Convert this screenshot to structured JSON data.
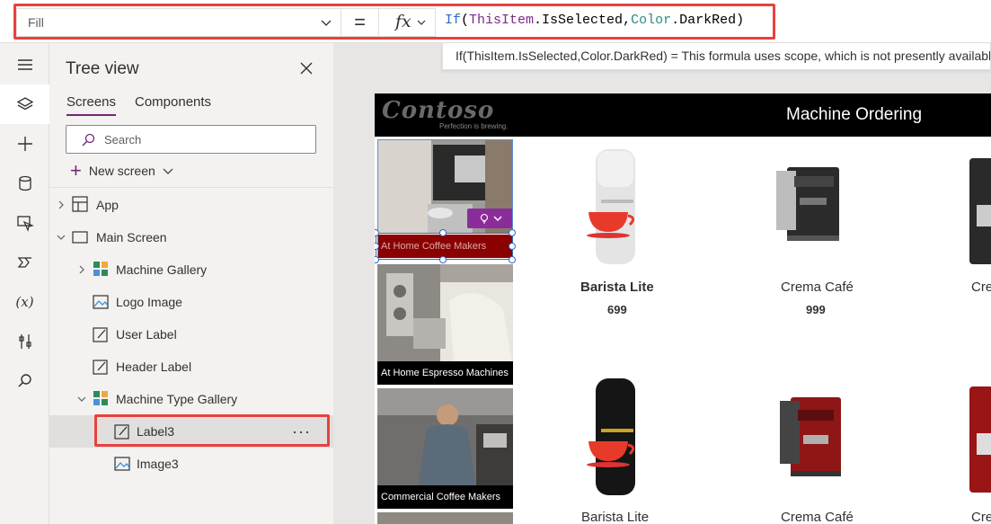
{
  "formula_bar": {
    "property": "Fill",
    "equals": "=",
    "fx": "fx",
    "formula_tokens": {
      "fn": "If",
      "open": "(",
      "id": "ThisItem",
      "dot1": ".IsSelected,",
      "cl": "Color",
      "dot2": ".DarkRed",
      "close": ")"
    },
    "hint": "If(ThisItem.IsSelected,Color.DarkRed)  =  This formula uses scope, which is not presently available for evaluation."
  },
  "rail": {
    "icons": [
      "hamburger-icon",
      "layers-icon",
      "plus-icon",
      "database-icon",
      "media-icon",
      "flow-icon",
      "variables-icon",
      "tools-icon",
      "search-icon"
    ],
    "variables_text": "(x)"
  },
  "tree": {
    "title": "Tree view",
    "tabs": [
      "Screens",
      "Components"
    ],
    "search_placeholder": "Search",
    "new_screen": "New screen",
    "nodes": {
      "app": "App",
      "main_screen": "Main Screen",
      "machine_gallery": "Machine Gallery",
      "logo_image": "Logo Image",
      "user_label": "User Label",
      "header_label": "Header Label",
      "machine_type_gallery": "Machine Type Gallery",
      "label3": "Label3",
      "image3": "Image3"
    },
    "more": "···"
  },
  "app": {
    "logo": "Contoso",
    "logo_tagline": "Perfection is brewing.",
    "title": "Machine Ordering",
    "types": [
      "At Home Coffee Makers",
      "At Home Espresso Machines",
      "Commercial Coffee Makers"
    ],
    "products": [
      {
        "name": "Barista Lite",
        "price": "699"
      },
      {
        "name": "Crema Café",
        "price": "999"
      },
      {
        "name": "Cre"
      },
      {
        "name": "Barista Lite"
      },
      {
        "name": "Crema Café"
      },
      {
        "name": "Cre"
      }
    ],
    "colors": {
      "selected_label": "#8b0000",
      "accent": "#742774",
      "highlight": "#e8413e"
    }
  }
}
